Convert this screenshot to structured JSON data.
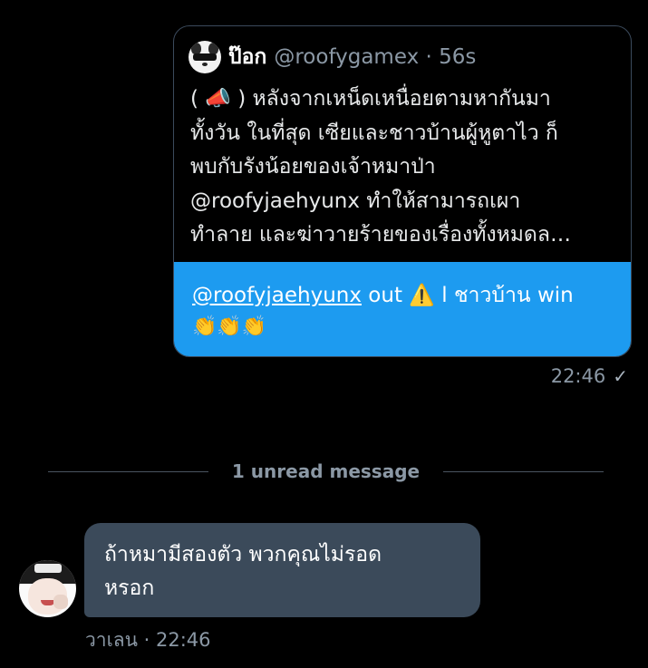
{
  "quoted_tweet": {
    "author_name": "ป๊อก",
    "author_handle": "@roofygamex · 56s",
    "avatar_icon": "dog-sunglasses-avatar",
    "text": "( 📣 ) หลังจากเหน็ดเหนื่อยตามหากันมา\nทั้งวัน ในที่สุด เซียและชาวบ้านผู้หูตาไว ก็\nพบกับรังน้อยของเจ้าหมาป่า\n@roofyjaehyunx    ทำให้สามารถเผา\nทำลาย และฆ่าวายร้ายของเรื่องทั้งหมดล…"
  },
  "outgoing_message": {
    "mention": "@roofyjaehyunx",
    "text_after_mention": " out ",
    "warning_emoji": "⚠️",
    "text_tail": " l ชาวบ้าน win",
    "claps": [
      "👏",
      "👏",
      "👏"
    ],
    "time": "22:46",
    "read_icon": "checkmark-icon"
  },
  "divider": {
    "label": "1 unread message"
  },
  "incoming_message": {
    "text": "ถ้าหมามีสองตัว พวกคุณไม่รอด\nหรอก",
    "sender_meta": "วาเลน · 22:46"
  },
  "colors": {
    "background": "#000000",
    "accent_blue": "#1d9bf0",
    "incoming_bubble": "#3b4a5a",
    "muted_text": "#8b98a5"
  }
}
